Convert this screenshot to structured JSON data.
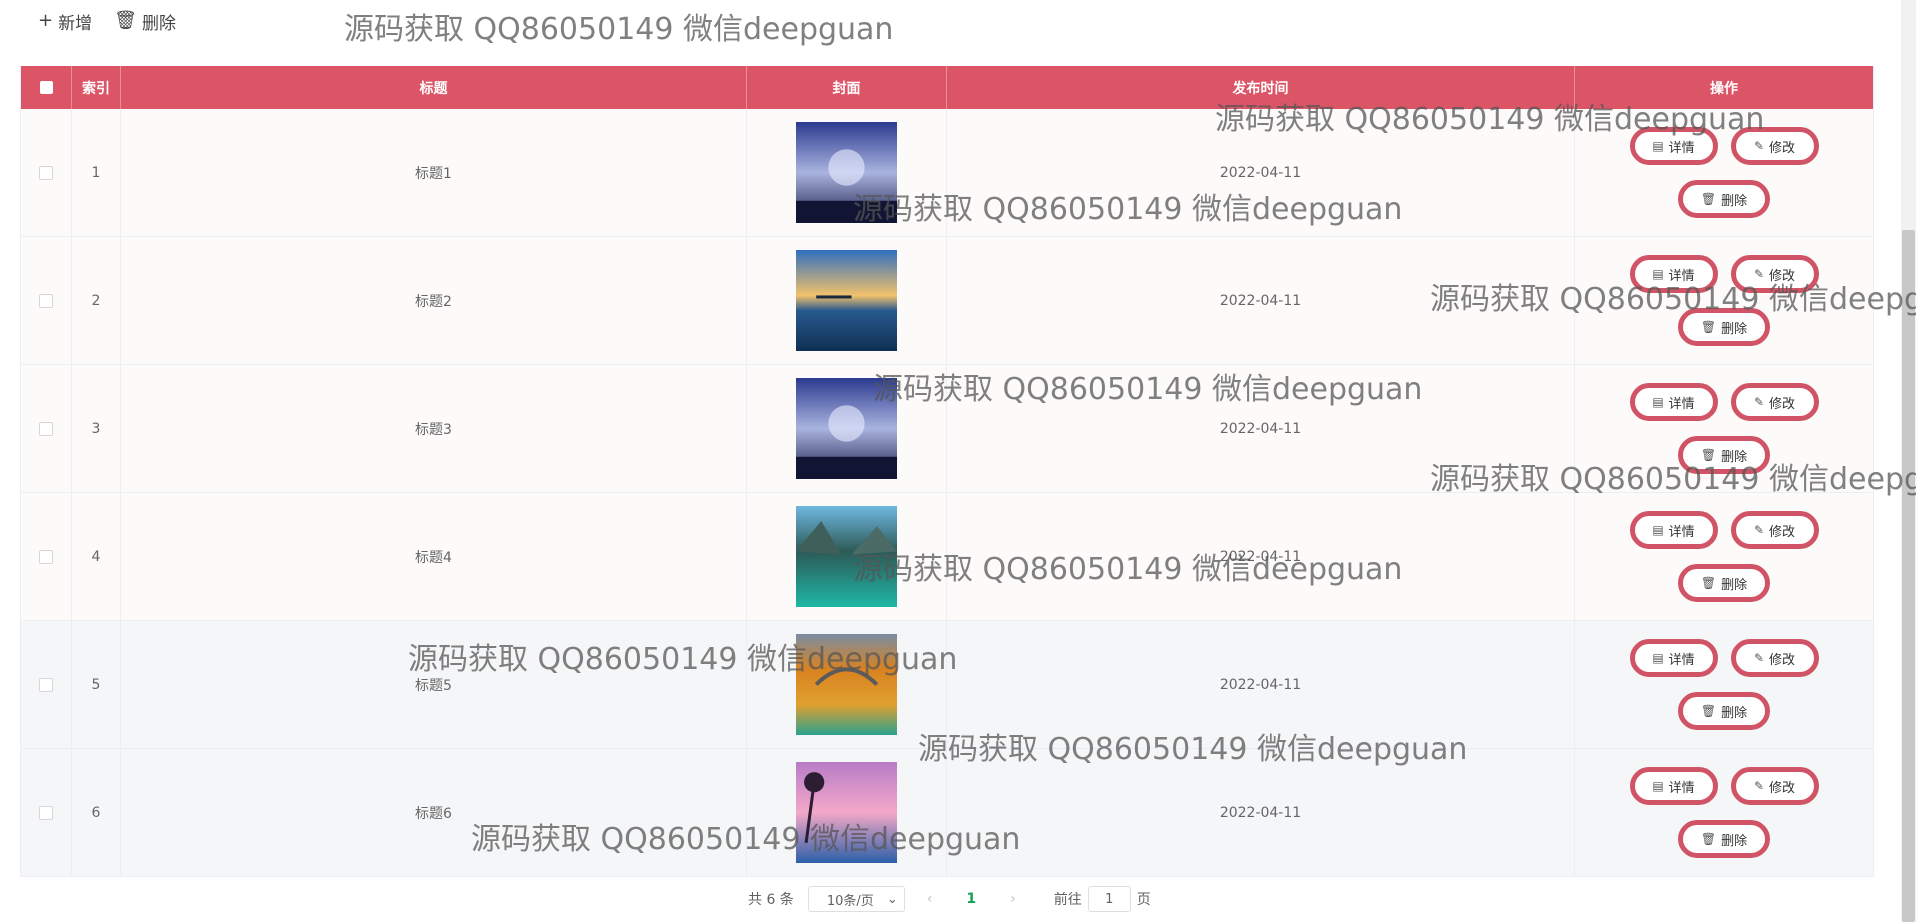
{
  "toolbar": {
    "add_label": "新增",
    "delete_label": "删除"
  },
  "table": {
    "headers": [
      "索引",
      "标题",
      "封面",
      "发布时间",
      "操作"
    ],
    "rows": [
      {
        "index": "1",
        "title": "标题1",
        "date": "2022-04-11",
        "cover_icon": "cover-landscape-icon"
      },
      {
        "index": "2",
        "title": "标题2",
        "date": "2022-04-11",
        "cover_icon": "cover-sunset-icon"
      },
      {
        "index": "3",
        "title": "标题3",
        "date": "2022-04-11",
        "cover_icon": "cover-landscape-icon"
      },
      {
        "index": "4",
        "title": "标题4",
        "date": "2022-04-11",
        "cover_icon": "cover-lake-icon"
      },
      {
        "index": "5",
        "title": "标题5",
        "date": "2022-04-11",
        "cover_icon": "cover-autumn-icon"
      },
      {
        "index": "6",
        "title": "标题6",
        "date": "2022-04-11",
        "cover_icon": "cover-beach-icon"
      }
    ],
    "actions": {
      "detail": "详情",
      "edit": "修改",
      "delete": "删除"
    }
  },
  "pagination": {
    "total": "共 6 条",
    "page_size": "10条/页",
    "current": "1",
    "goto_label": "前往",
    "goto_value": "1",
    "page_unit": "页"
  },
  "watermark": "源码获取 QQ86050149 微信deepguan",
  "colors": {
    "header": "#dc5566",
    "action_border": "#d05466",
    "active_page": "#18a058"
  }
}
